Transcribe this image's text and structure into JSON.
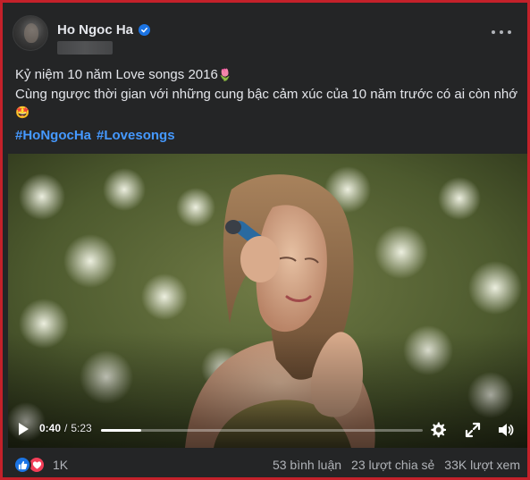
{
  "post": {
    "author": "Ho Ngoc Ha",
    "caption_line1": "Kỷ niệm 10 năm Love songs 2016",
    "caption_line1_emoji": "🌷",
    "caption_line2": "Cùng ngược thời gian với những cung bậc cảm xúc của 10 năm trước có ai còn nhớ",
    "caption_line3_emoji": "🤩",
    "hashtags": [
      "#HoNgocHa",
      "#Lovesongs"
    ]
  },
  "video": {
    "elapsed": "0:40",
    "separator": "/",
    "duration": "5:23",
    "progress_fraction": 0.124
  },
  "footer": {
    "reaction_count": "1K",
    "comments": "53 bình luận",
    "shares": "23 lượt chia sẻ",
    "views": "33K lượt xem"
  },
  "colors": {
    "frame_border": "#c4212a",
    "background": "#242526",
    "hashtag": "#4599ff",
    "like": "#1b74e4",
    "love": "#f33e58"
  },
  "icons": [
    "verified-badge-icon",
    "more-options-icon",
    "play-icon",
    "settings-gear-icon",
    "fullscreen-icon",
    "volume-icon",
    "like-reaction-icon",
    "love-reaction-icon"
  ]
}
